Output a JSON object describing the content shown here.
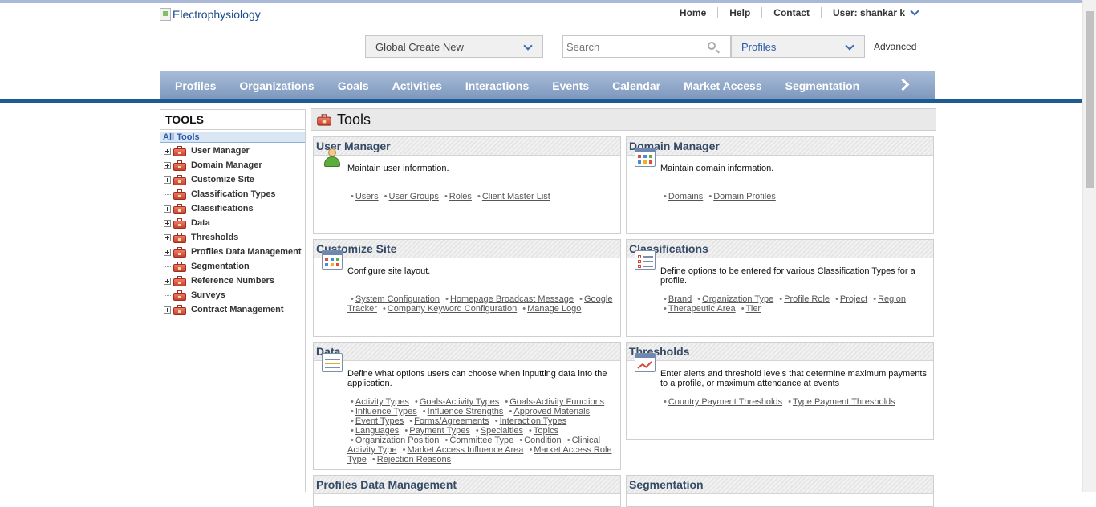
{
  "header": {
    "logo_alt": "Electrophysiology",
    "top_links": [
      "Home",
      "Help",
      "Contact"
    ],
    "user_label": "User: shankar k"
  },
  "toolbar": {
    "create_new": "Global Create New",
    "search_placeholder": "Search",
    "search_scope": "Profiles",
    "advanced": "Advanced"
  },
  "main_nav": [
    "Profiles",
    "Organizations",
    "Goals",
    "Activities",
    "Interactions",
    "Events",
    "Calendar",
    "Market Access",
    "Segmentation"
  ],
  "sidebar": {
    "title": "TOOLS",
    "all_tools": "All Tools",
    "items": [
      {
        "label": "User Manager",
        "expandable": true
      },
      {
        "label": "Domain Manager",
        "expandable": true
      },
      {
        "label": "Customize Site",
        "expandable": true
      },
      {
        "label": "Classification Types",
        "expandable": false
      },
      {
        "label": "Classifications",
        "expandable": true
      },
      {
        "label": "Data",
        "expandable": true
      },
      {
        "label": "Thresholds",
        "expandable": true
      },
      {
        "label": "Profiles Data Management",
        "expandable": true
      },
      {
        "label": "Segmentation",
        "expandable": false
      },
      {
        "label": "Reference Numbers",
        "expandable": true
      },
      {
        "label": "Surveys",
        "expandable": false
      },
      {
        "label": "Contract Management",
        "expandable": true
      }
    ]
  },
  "content": {
    "title": "Tools",
    "panels": {
      "user_manager": {
        "title": "User Manager",
        "icon": "user-icon",
        "desc": "Maintain user information.",
        "links": [
          "Users",
          "User Groups",
          "Roles",
          "Client Master List"
        ]
      },
      "domain_manager": {
        "title": "Domain Manager",
        "icon": "calendar-grid-icon",
        "desc": "Maintain domain information.",
        "links": [
          "Domains",
          "Domain Profiles"
        ]
      },
      "customize_site": {
        "title": "Customize Site",
        "icon": "calendar-grid-icon",
        "desc": "Configure site layout.",
        "links": [
          "System Configuration",
          "Homepage Broadcast Message",
          "Google Tracker",
          "Company Keyword Configuration",
          "Manage Logo"
        ]
      },
      "classifications": {
        "title": "Classifications",
        "icon": "checklist-icon",
        "desc": "Define options to be entered for various Classification Types for a profile.",
        "links": [
          "Brand",
          "Organization Type",
          "Profile Role",
          "Project",
          "Region",
          "Therapeutic Area",
          "Tier"
        ]
      },
      "data": {
        "title": "Data",
        "icon": "form-icon",
        "desc": "Define what options users can choose when inputting data into the application.",
        "links": [
          "Activity Types",
          "Goals-Activity Types",
          "Goals-Activity Functions",
          "Influence Types",
          "Influence Strengths",
          "Approved Materials",
          "Event Types",
          "Forms/Agreements",
          "Interaction Types",
          "Languages",
          "Payment Types",
          "Specialties",
          "Topics",
          "Organization Position",
          "Committee Type",
          "Condition",
          "Clinical Activity Type",
          "Market Access Influence Area",
          "Market Access Role Type",
          "Rejection Reasons"
        ]
      },
      "thresholds": {
        "title": "Thresholds",
        "icon": "trend-chart-icon",
        "desc": "Enter alerts and threshold levels that determine maximum payments to a profile, or maximum attendance at events",
        "links": [
          "Country Payment Thresholds",
          "Type Payment Thresholds"
        ]
      },
      "profiles_data_management": {
        "title": "Profiles Data Management"
      },
      "segmentation": {
        "title": "Segmentation"
      }
    }
  }
}
